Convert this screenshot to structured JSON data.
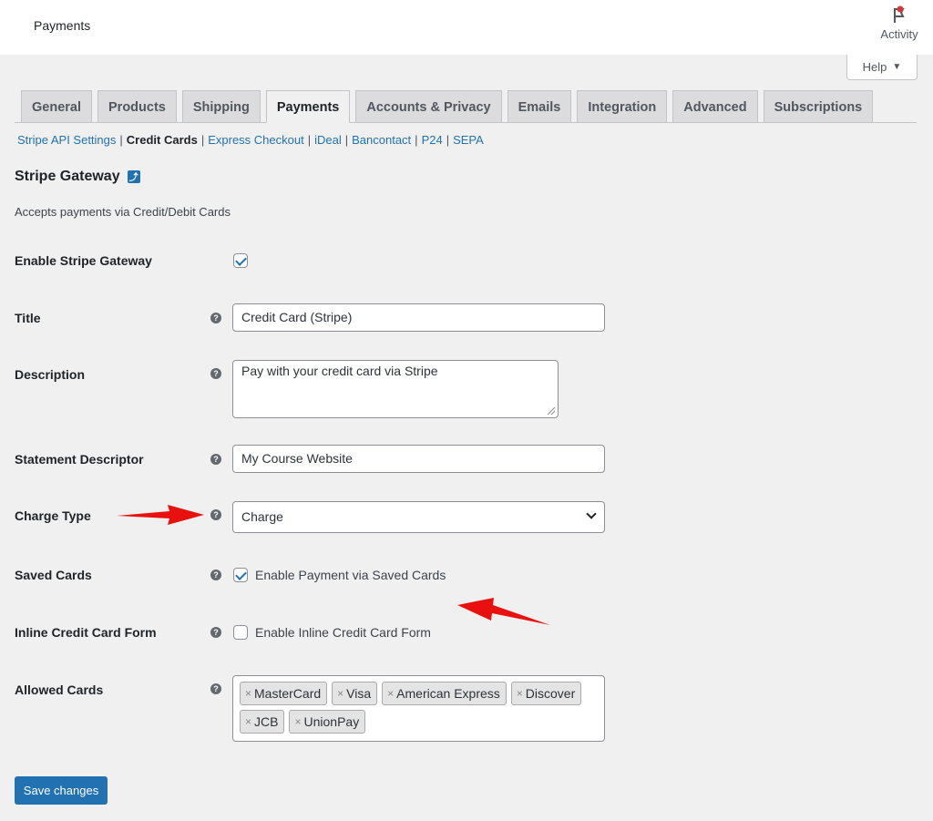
{
  "header": {
    "title": "Payments",
    "activity_label": "Activity",
    "help_label": "Help"
  },
  "tabs": [
    {
      "label": "General"
    },
    {
      "label": "Products"
    },
    {
      "label": "Shipping"
    },
    {
      "label": "Payments",
      "active": true
    },
    {
      "label": "Accounts & Privacy"
    },
    {
      "label": "Emails"
    },
    {
      "label": "Integration"
    },
    {
      "label": "Advanced"
    },
    {
      "label": "Subscriptions"
    }
  ],
  "subnav": {
    "items": [
      "Stripe API Settings",
      "Credit Cards",
      "Express Checkout",
      "iDeal",
      "Bancontact",
      "P24",
      "SEPA"
    ],
    "current": "Credit Cards"
  },
  "section": {
    "title": "Stripe Gateway",
    "description": "Accepts payments via Credit/Debit Cards"
  },
  "fields": {
    "enable": {
      "label": "Enable Stripe Gateway",
      "checked": true
    },
    "title": {
      "label": "Title",
      "value": "Credit Card (Stripe)"
    },
    "description": {
      "label": "Description",
      "value": "Pay with your credit card via Stripe"
    },
    "statement_descriptor": {
      "label": "Statement Descriptor",
      "value": "My Course Website"
    },
    "charge_type": {
      "label": "Charge Type",
      "value": "Charge"
    },
    "saved_cards": {
      "label": "Saved Cards",
      "checkbox_label": "Enable Payment via Saved Cards",
      "checked": true
    },
    "inline_form": {
      "label": "Inline Credit Card Form",
      "checkbox_label": "Enable Inline Credit Card Form",
      "checked": false
    },
    "allowed_cards": {
      "label": "Allowed Cards",
      "tags": [
        "MasterCard",
        "Visa",
        "American Express",
        "Discover",
        "JCB",
        "UnionPay"
      ]
    }
  },
  "help_tip_glyph": "?",
  "tag_remove_glyph": "×",
  "save_label": "Save changes",
  "colors": {
    "accent": "#2271b1",
    "arrow": "#e8110f",
    "notification_dot": "#d63638"
  }
}
